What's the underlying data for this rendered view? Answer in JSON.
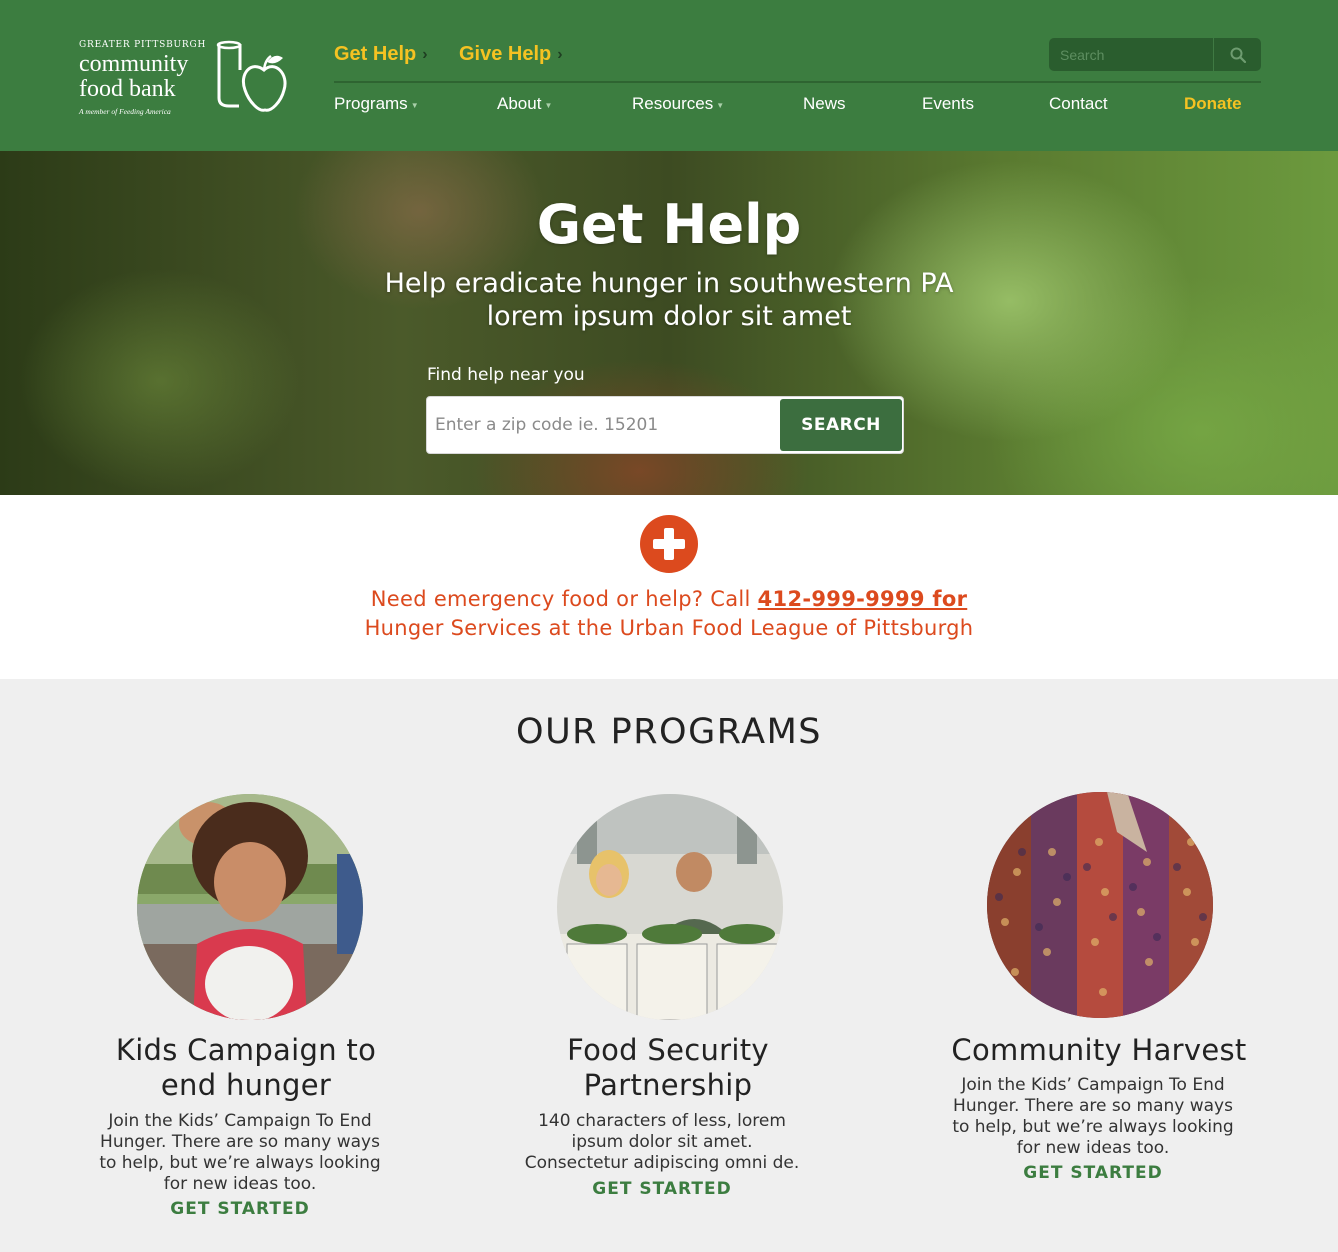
{
  "header": {
    "logo": {
      "line1": "GREATER PITTSBURGH",
      "line2": "community",
      "line3": "food bank",
      "tagline": "A member of Feeding America"
    },
    "primary_links": [
      {
        "label": "Get Help"
      },
      {
        "label": "Give Help"
      }
    ],
    "search_placeholder": "Search",
    "nav": [
      {
        "label": "Programs",
        "has_dropdown": true
      },
      {
        "label": "About",
        "has_dropdown": true
      },
      {
        "label": "Resources",
        "has_dropdown": true
      },
      {
        "label": "News",
        "has_dropdown": false
      },
      {
        "label": "Events",
        "has_dropdown": false
      },
      {
        "label": "Contact",
        "has_dropdown": false
      },
      {
        "label": "Donate",
        "has_dropdown": false
      }
    ]
  },
  "hero": {
    "title": "Get Help",
    "subtitle_line1": "Help eradicate hunger in southwestern PA",
    "subtitle_line2": "lorem ipsum dolor sit amet",
    "find_label": "Find help near you",
    "zip_placeholder": "Enter a zip code ie. 15201",
    "search_button": "SEARCH"
  },
  "emergency": {
    "text_before": "Need emergency food or help? Call ",
    "link_text": "412-999-9999 for",
    "line2": "Hunger Services at the Urban Food League of Pittsburgh"
  },
  "programs": {
    "title": "OUR PROGRAMS",
    "items": [
      {
        "title_line1": "Kids Campaign to",
        "title_line2": "end hunger",
        "desc": [
          "Join the Kids’ Campaign To End",
          "Hunger. There are so many ways",
          "to help, but we’re always looking",
          "for new ideas too."
        ],
        "cta": "GET STARTED"
      },
      {
        "title_line1": "Food Security",
        "title_line2": "Partnership",
        "desc": [
          "140 characters of less, lorem",
          "ipsum dolor sit amet.",
          "Consectetur adipiscing omni de."
        ],
        "cta": "GET STARTED"
      },
      {
        "title_line1": "Community Harvest",
        "title_line2": "",
        "desc": [
          "Join the Kids’ Campaign To End",
          "Hunger. There are so many ways",
          "to help, but we’re always looking",
          "for new ideas too."
        ],
        "cta": "GET STARTED"
      }
    ]
  },
  "colors": {
    "header_green": "#3c7d40",
    "accent_yellow": "#f5c222",
    "emergency_orange": "#dc4a1e",
    "button_green": "#3c6e3f",
    "section_gray": "#efefef"
  },
  "icons": [
    "logo-can-apple-icon",
    "search-icon",
    "chevron-right-icon",
    "caret-down-icon",
    "plus-icon"
  ]
}
